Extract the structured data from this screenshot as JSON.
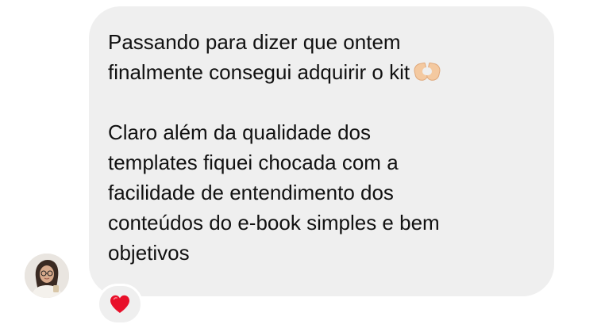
{
  "message": {
    "text": "Passando para dizer que ontem\nfinalmente consegui adquirir o kit",
    "text2": "Claro além da qualidade dos\ntemplates fiquei chocada com a\nfacilidade de entendimento dos\nconteúdos do e-book simples e bem\nobjetivos",
    "inline_emoji": "heart-hands-icon"
  },
  "reaction": {
    "icon": "red-heart-icon",
    "color": "#e8102a"
  },
  "sender": {
    "avatar": "avatar"
  },
  "colors": {
    "bubble": "#efefef",
    "text": "#111111",
    "background": "#ffffff"
  }
}
